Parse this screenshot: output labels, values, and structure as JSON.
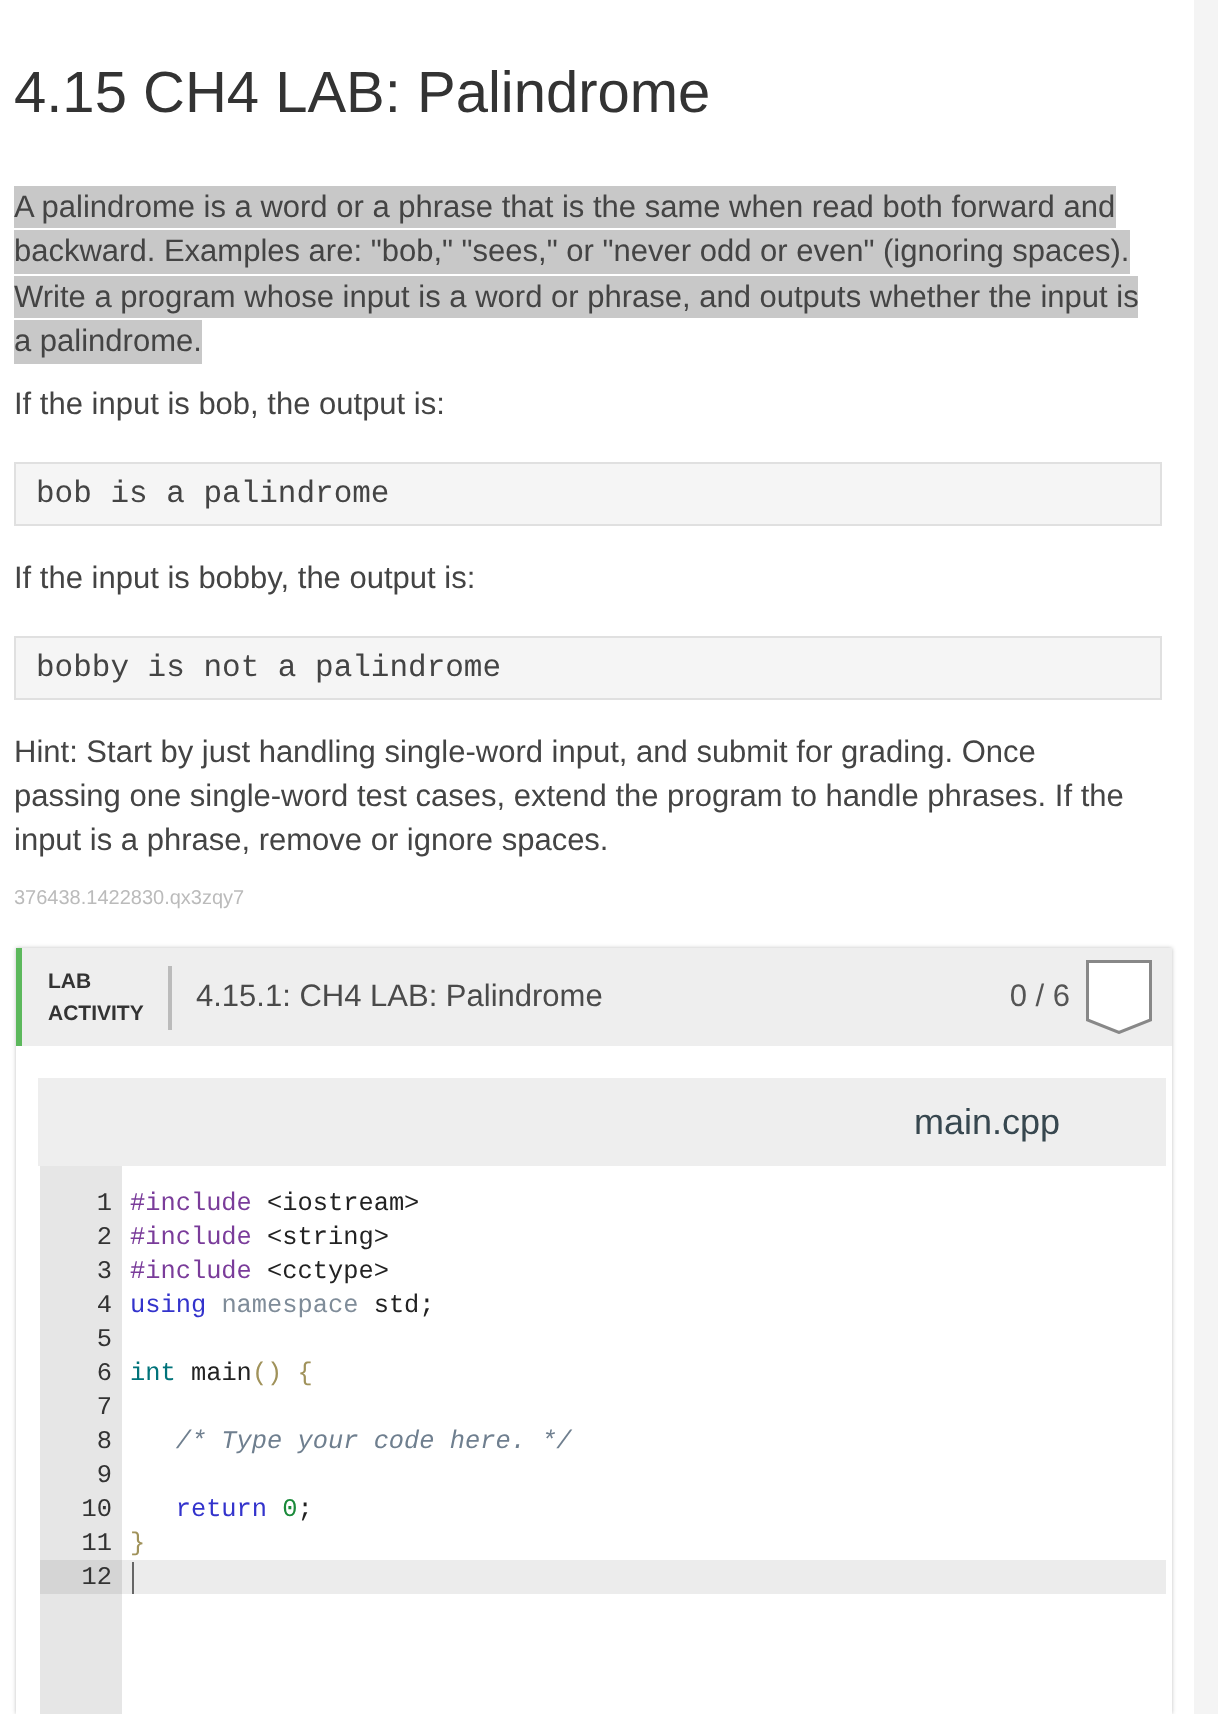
{
  "title": "4.15 CH4 LAB: Palindrome",
  "description": {
    "text": "A palindrome is a word or a phrase that is the same when read both forward and backward. Examples are: \"bob,\" \"sees,\" or \"never odd or even\" (ignoring spaces). Write a program whose input is a word or phrase, and outputs whether the input is a palindrome.",
    "highlighted": true
  },
  "examples": [
    {
      "prompt": "If the input is bob, the output is:",
      "output": "bob is a palindrome"
    },
    {
      "prompt": "If the input is bobby, the output is:",
      "output": "bobby is not a palindrome"
    }
  ],
  "hint": "Hint: Start by just handling single-word input, and submit for grading. Once passing one single-word test cases, extend the program to handle phrases. If the input is a phrase, remove or ignore spaces.",
  "reference_id": "376438.1422830.qx3zqy7",
  "lab_activity": {
    "label": "LAB ACTIVITY",
    "title": "4.15.1: CH4 LAB: Palindrome",
    "score": "0 / 6",
    "completed": false,
    "editor": {
      "filename": "main.cpp",
      "lines": [
        {
          "number": "1",
          "active": false,
          "tokens": [
            {
              "kind": "meta",
              "text": "#include "
            },
            {
              "kind": "plain",
              "text": "<iostream>"
            }
          ]
        },
        {
          "number": "2",
          "active": false,
          "tokens": [
            {
              "kind": "meta",
              "text": "#include "
            },
            {
              "kind": "plain",
              "text": "<string>"
            }
          ]
        },
        {
          "number": "3",
          "active": false,
          "tokens": [
            {
              "kind": "meta",
              "text": "#include "
            },
            {
              "kind": "plain",
              "text": "<cctype>"
            }
          ]
        },
        {
          "number": "4",
          "active": false,
          "tokens": [
            {
              "kind": "keyword",
              "text": "using "
            },
            {
              "kind": "variable",
              "text": "namespace "
            },
            {
              "kind": "plain",
              "text": "std;"
            }
          ]
        },
        {
          "number": "5",
          "active": false
        },
        {
          "number": "6",
          "active": false,
          "tokens": [
            {
              "kind": "type",
              "text": "int "
            },
            {
              "kind": "plain",
              "text": "main"
            },
            {
              "kind": "bracket",
              "text": "() {"
            }
          ]
        },
        {
          "number": "7",
          "active": false
        },
        {
          "number": "8",
          "active": false,
          "tokens": [
            {
              "kind": "comment",
              "text": "   /* Type your code here. */"
            }
          ]
        },
        {
          "number": "9",
          "active": false
        },
        {
          "number": "10",
          "active": false,
          "tokens": [
            {
              "kind": "keyword",
              "text": "   return "
            },
            {
              "kind": "number",
              "text": "0"
            },
            {
              "kind": "plain",
              "text": ";"
            }
          ]
        },
        {
          "number": "11",
          "active": false,
          "tokens": [
            {
              "kind": "bracket",
              "text": "}"
            }
          ]
        },
        {
          "number": "12",
          "active": true
        }
      ]
    }
  }
}
